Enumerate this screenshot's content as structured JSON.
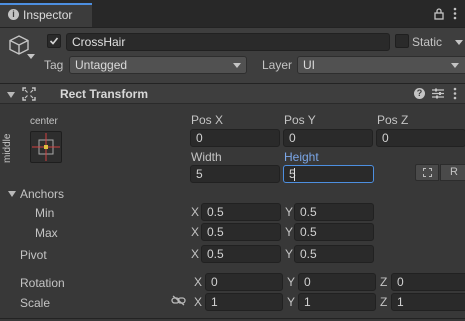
{
  "window": {
    "tab_title": "Inspector"
  },
  "object": {
    "name": "CrossHair",
    "static_label": "Static",
    "tag_label": "Tag",
    "tag_value": "Untagged",
    "layer_label": "Layer",
    "layer_value": "UI"
  },
  "component": {
    "title": "Rect Transform"
  },
  "anchor_preset": {
    "horizontal": "center",
    "vertical": "middle"
  },
  "position": {
    "pos_x_label": "Pos X",
    "pos_x": "0",
    "pos_y_label": "Pos Y",
    "pos_y": "0",
    "pos_z_label": "Pos Z",
    "pos_z": "0",
    "width_label": "Width",
    "width": "5",
    "height_label": "Height",
    "height": "5",
    "raw_button": "R"
  },
  "anchors": {
    "label": "Anchors",
    "min_label": "Min",
    "min_x": "0.5",
    "min_y": "0.5",
    "max_label": "Max",
    "max_x": "0.5",
    "max_y": "0.5"
  },
  "pivot": {
    "label": "Pivot",
    "x": "0.5",
    "y": "0.5"
  },
  "rotation": {
    "label": "Rotation",
    "x": "0",
    "y": "0",
    "z": "0"
  },
  "scale": {
    "label": "Scale",
    "x": "1",
    "y": "1",
    "z": "1"
  },
  "axes": {
    "x": "X",
    "y": "Y",
    "z": "Z"
  },
  "colors": {
    "background": "#383838",
    "field": "#2a2a2a",
    "header": "#3e3e3e",
    "accent": "#4d8fe0",
    "active_label": "#7ba7e8"
  },
  "icons": [
    "info-icon",
    "lock-icon",
    "more-vert-icon",
    "cube-icon",
    "dropdown-arrow-icon",
    "rect-transform-icon",
    "help-icon",
    "presets-icon",
    "chain-link-icon",
    "blueprint-icon"
  ]
}
